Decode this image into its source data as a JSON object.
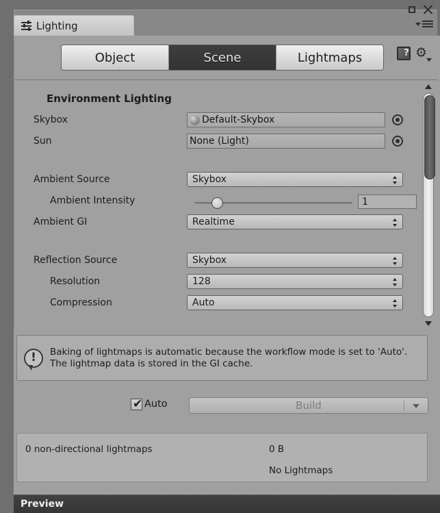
{
  "window": {
    "tab_title": "Lighting",
    "tab_icon": "sliders-icon",
    "maximize_icon": "maximize-icon",
    "close_icon": "close-icon",
    "menu_icon": "hamburger-menu-icon"
  },
  "toolbar": {
    "tabs": [
      {
        "label": "Object",
        "active": false
      },
      {
        "label": "Scene",
        "active": true
      },
      {
        "label": "Lightmaps",
        "active": false
      }
    ],
    "help_icon": "help-book-icon",
    "help_glyph": "?",
    "settings_icon": "gear-icon",
    "settings_glyph": "⚙"
  },
  "environment": {
    "section_title": "Environment Lighting",
    "skybox": {
      "label": "Skybox",
      "value": "Default-Skybox",
      "thumb_icon": "sphere-material-icon",
      "picker_icon": "object-picker-icon"
    },
    "sun": {
      "label": "Sun",
      "value": "None (Light)",
      "picker_icon": "object-picker-icon"
    },
    "ambient_source": {
      "label": "Ambient Source",
      "value": "Skybox"
    },
    "ambient_intensity": {
      "label": "Ambient Intensity",
      "value": "1",
      "slider_percent": 15
    },
    "ambient_gi": {
      "label": "Ambient GI",
      "value": "Realtime"
    },
    "reflection_source": {
      "label": "Reflection Source",
      "value": "Skybox"
    },
    "resolution": {
      "label": "Resolution",
      "value": "128"
    },
    "compression": {
      "label": "Compression",
      "value": "Auto"
    }
  },
  "scrollbar": {
    "up_arrow_icon": "scroll-up-arrow-icon",
    "down_arrow_icon": "scroll-down-arrow-icon"
  },
  "info": {
    "icon": "info-speech-bubble-icon",
    "glyph": "!",
    "message": "Baking of lightmaps is automatic because the workflow mode is set to 'Auto'. The lightmap data is stored in the GI cache."
  },
  "build_row": {
    "auto_label": "Auto",
    "auto_checked": true,
    "check_glyph": "✔",
    "build_label": "Build",
    "dropdown_icon": "chevron-down-icon"
  },
  "stats": {
    "lightmaps_count": "0 non-directional lightmaps",
    "size": "0 B",
    "status": "No Lightmaps"
  },
  "preview": {
    "label": "Preview"
  }
}
